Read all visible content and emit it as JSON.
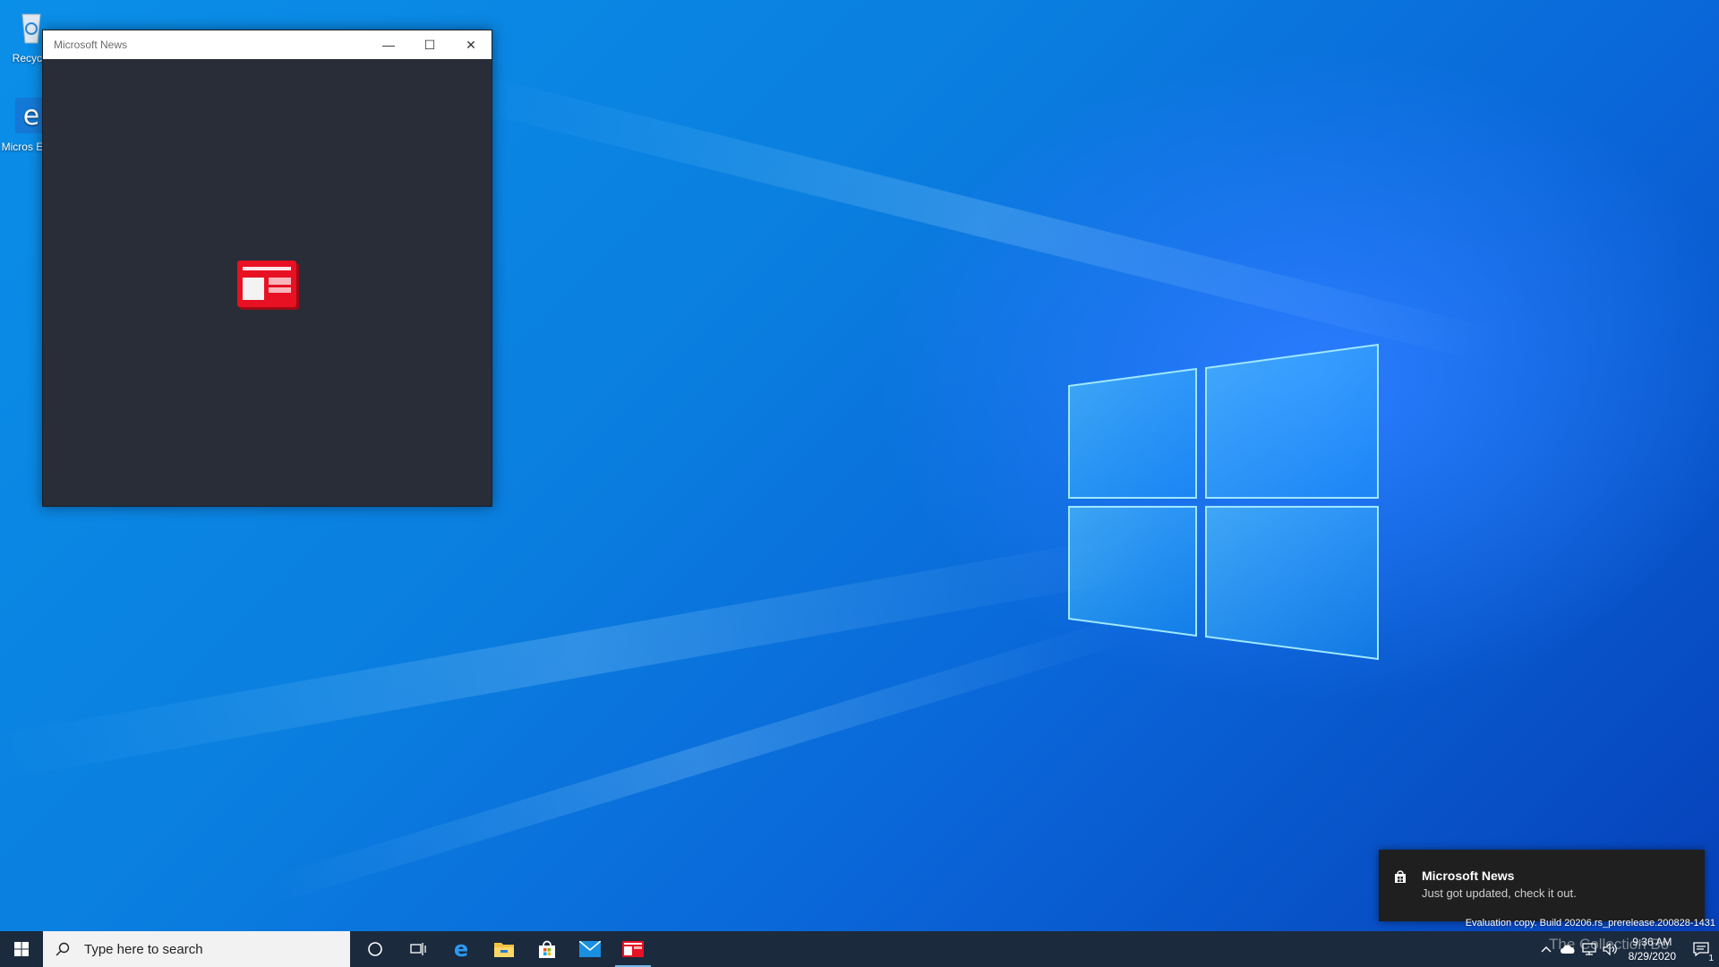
{
  "desktop": {
    "icons": [
      {
        "label": "Recycle",
        "icon": "recycle-bin-icon"
      },
      {
        "label": "Micros Edge",
        "icon": "edge-icon"
      }
    ]
  },
  "window": {
    "title": "Microsoft News",
    "minimize": "—",
    "maximize": "☐",
    "close": "✕"
  },
  "toast": {
    "title": "Microsoft News",
    "body": "Just got updated, check it out."
  },
  "build_text": "Evaluation copy. Build 20206.rs_prerelease.200828-1431",
  "taskbar": {
    "search_placeholder": "Type here to search",
    "pinned": [
      "cortana-icon",
      "task-view-icon",
      "edge-icon",
      "file-explorer-icon",
      "store-icon",
      "mail-icon",
      "news-icon"
    ],
    "time": "9:36 AM",
    "date": "8/29/2020",
    "notification_count": "1"
  },
  "watermark": "The Collection Bo",
  "colors": {
    "taskbar": "#1b2a3d",
    "window_bg": "#282d37",
    "news_red": "#e81123",
    "accent": "#0078d7"
  }
}
